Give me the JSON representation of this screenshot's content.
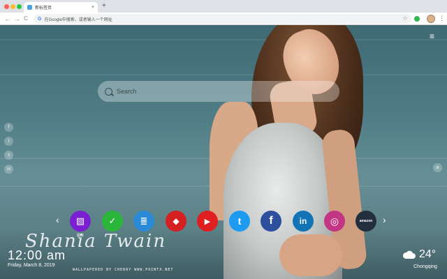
{
  "browser": {
    "tab_title": "新标签页",
    "tab_close": "×",
    "new_tab": "+",
    "back": "←",
    "forward": "→",
    "reload": "C",
    "google_letter": "G",
    "omnibox_text": "在Google中搜索，或者输入一个网址",
    "bookmark_star": "☆",
    "menu": "⋮"
  },
  "page": {
    "menu_icon": "≡",
    "search_placeholder": "Search",
    "social_icons": [
      {
        "name": "facebook",
        "glyph": "f"
      },
      {
        "name": "twitter",
        "glyph": "t"
      },
      {
        "name": "snapchat",
        "glyph": "s"
      },
      {
        "name": "wechat",
        "glyph": "w"
      }
    ],
    "side_toggle": "o",
    "arrow_left": "‹",
    "arrow_right": "›",
    "apps": [
      {
        "name": "gallery",
        "label": "图库",
        "color": "#7a1fd1",
        "glyph": "▨"
      },
      {
        "name": "tasks",
        "label": "",
        "color": "#2bb53a",
        "glyph": "✓"
      },
      {
        "name": "notes",
        "label": "",
        "color": "#2a8ad6",
        "glyph": "≣"
      },
      {
        "name": "game",
        "label": "",
        "color": "#d42020",
        "glyph": "◆"
      },
      {
        "name": "youtube",
        "label": "",
        "color": "#e02020",
        "glyph": "▶"
      },
      {
        "name": "twitter",
        "label": "",
        "color": "#1d9bf0",
        "glyph": "t"
      },
      {
        "name": "facebook",
        "label": "",
        "color": "#2d4f9e",
        "glyph": "f"
      },
      {
        "name": "linkedin",
        "label": "",
        "color": "#1273b5",
        "glyph": "in"
      },
      {
        "name": "instagram",
        "label": "",
        "color": "#c13584",
        "glyph": "◎"
      },
      {
        "name": "amazon",
        "label": "",
        "color": "#232f3e",
        "glyph": "amazon"
      }
    ],
    "signature": "Shania Twain",
    "credit": "WALLPAPERED BY CHERRY WWW.POINTX.NET",
    "clock": "12:00 am",
    "date": "Friday, March 8, 2019",
    "temperature": "24°",
    "city": "Chongqing"
  }
}
